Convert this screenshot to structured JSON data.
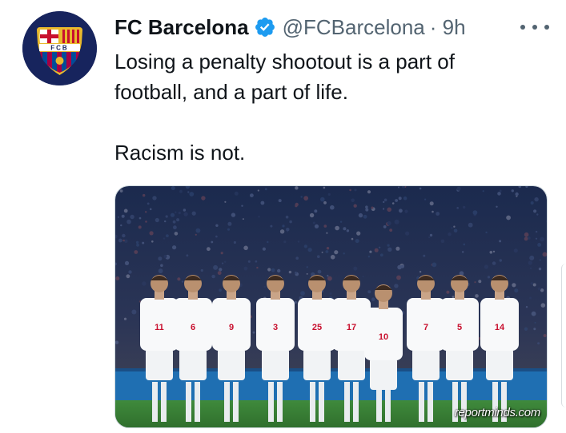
{
  "account": {
    "name": "FC Barcelona",
    "handle": "@FCBarcelona",
    "time": "· 9h",
    "verified": true,
    "avatar_label": "FCB"
  },
  "tweet": {
    "text": "Losing a penalty shootout is a part of\nfootball, and a part of life.\n\nRacism is not."
  },
  "media": {
    "watermark": "reportminds.com",
    "jersey_numbers": [
      "11",
      "6",
      "9",
      "3",
      "25",
      "17",
      "10",
      "7",
      "5",
      "14"
    ]
  },
  "colors": {
    "text": "#0f1419",
    "secondary": "#536471",
    "verified": "#1d9bf0",
    "avatar_bg": "#17245d"
  },
  "icons": {
    "verified": "verified-badge-icon",
    "more": "more-options-icon"
  }
}
